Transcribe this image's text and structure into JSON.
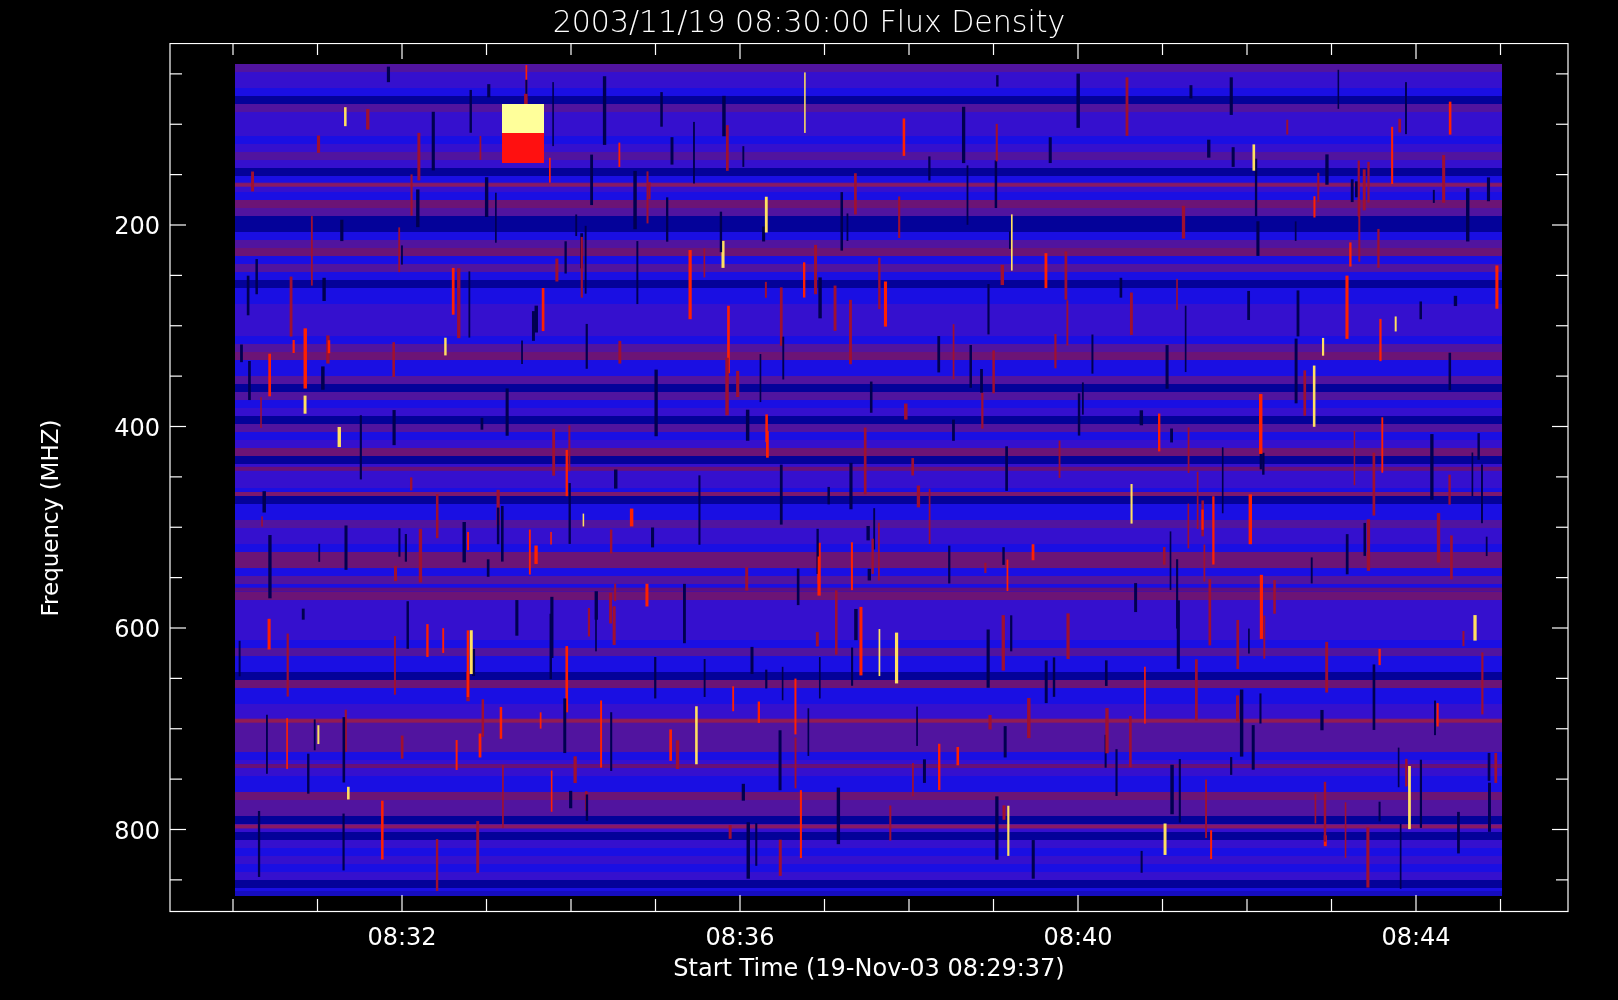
{
  "title": "2003/11/19 08:30:00 Flux Density",
  "y_axis": {
    "label": "Frequency (MHZ)",
    "ticks": [
      "200",
      "400",
      "600",
      "800"
    ]
  },
  "x_axis": {
    "label": "Start Time (19-Nov-03 08:29:37)",
    "ticks": [
      "08:32",
      "08:36",
      "08:40",
      "08:44"
    ]
  }
}
